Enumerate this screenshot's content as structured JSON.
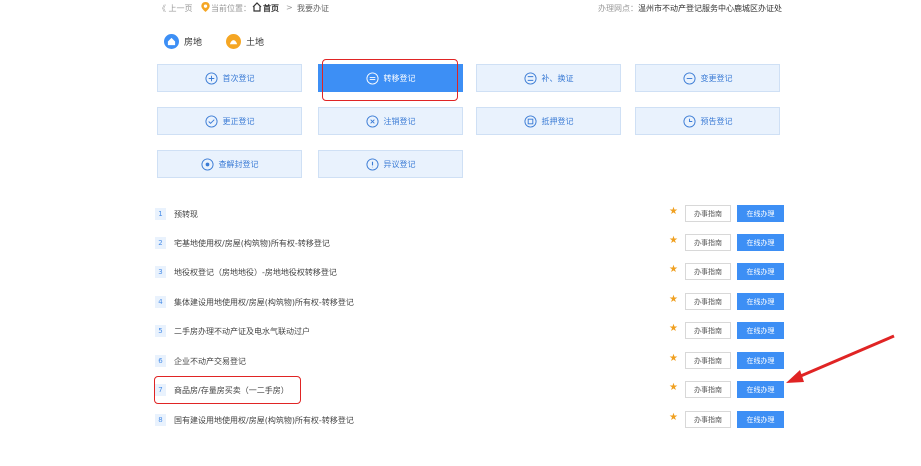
{
  "topbar": {
    "back_label": "《 上一页",
    "location_label": "当前位置：",
    "home_link": "首页",
    "separator": ">",
    "current_page": "我要办证",
    "site_label": "办理网点：",
    "site_name": "温州市不动产登记服务中心鹿城区办证处"
  },
  "categories": [
    {
      "label": "房地",
      "icon": "house-icon",
      "color": "#3d8ff5"
    },
    {
      "label": "土地",
      "icon": "land-icon",
      "color": "#f5a623"
    }
  ],
  "services": [
    {
      "label": "首次登记",
      "active": false
    },
    {
      "label": "转移登记",
      "active": true
    },
    {
      "label": "补、换证",
      "active": false
    },
    {
      "label": "变更登记",
      "active": false
    },
    {
      "label": "更正登记",
      "active": false
    },
    {
      "label": "注销登记",
      "active": false
    },
    {
      "label": "抵押登记",
      "active": false
    },
    {
      "label": "预告登记",
      "active": false
    },
    {
      "label": "查解封登记",
      "active": false
    },
    {
      "label": "异议登记",
      "active": false
    }
  ],
  "items": [
    {
      "num": "1",
      "name": "预转现"
    },
    {
      "num": "2",
      "name": "宅基地使用权/房屋(构筑物)所有权-转移登记"
    },
    {
      "num": "3",
      "name": "地役权登记（房地地役）-房地地役权转移登记"
    },
    {
      "num": "4",
      "name": "集体建设用地使用权/房屋(构筑物)所有权-转移登记"
    },
    {
      "num": "5",
      "name": "二手房办理不动产证及电水气联动过户"
    },
    {
      "num": "6",
      "name": "企业不动产交易登记"
    },
    {
      "num": "7",
      "name": "商品房/存量房买卖（一二手房）"
    },
    {
      "num": "8",
      "name": "国有建设用地使用权/房屋(构筑物)所有权-转移登记"
    }
  ],
  "actions": {
    "guide_label": "办事指南",
    "online_label": "在线办理",
    "star": "★"
  },
  "colors": {
    "primary": "#3d8ff5",
    "highlight": "#e02424",
    "star": "#f0a020"
  }
}
